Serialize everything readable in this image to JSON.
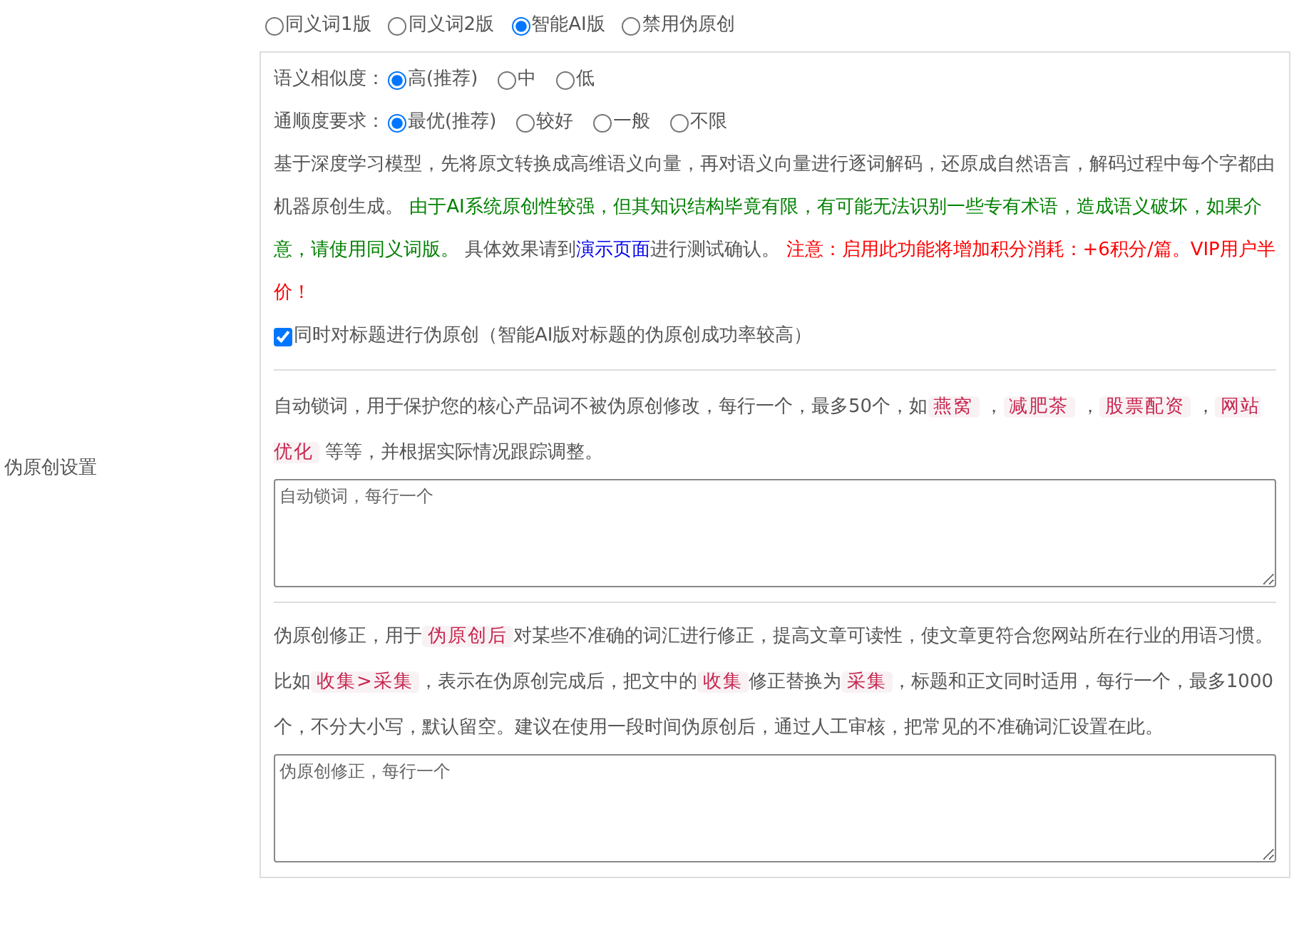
{
  "section_label": "伪原创设置",
  "modes": [
    {
      "label": "同义词1版",
      "selected": false
    },
    {
      "label": "同义词2版",
      "selected": false
    },
    {
      "label": "智能AI版",
      "selected": true
    },
    {
      "label": "禁用伪原创",
      "selected": false
    }
  ],
  "similarity": {
    "label": "语义相似度：",
    "options": [
      {
        "label": "高(推荐)",
        "selected": true
      },
      {
        "label": "中",
        "selected": false
      },
      {
        "label": "低",
        "selected": false
      }
    ]
  },
  "fluency": {
    "label": "通顺度要求：",
    "options": [
      {
        "label": "最优(推荐)",
        "selected": true
      },
      {
        "label": "较好",
        "selected": false
      },
      {
        "label": "一般",
        "selected": false
      },
      {
        "label": "不限",
        "selected": false
      }
    ]
  },
  "ai_description": [
    {
      "kind": "text",
      "text": "基于深度学习模型，先将原文转换成高维语义向量，再对语义向量进行逐词解码，还原成自然语言，解码过程中每个字都由机器原创生成。 "
    },
    {
      "kind": "green",
      "text": "由于AI系统原创性较强，但其知识结构毕竟有限，有可能无法识别一些专有术语，造成语义破坏，如果介意，请使用同义词版。"
    },
    {
      "kind": "text",
      "text": " 具体效果请到"
    },
    {
      "kind": "link",
      "text": "演示页面"
    },
    {
      "kind": "text",
      "text": "进行测试确认。 "
    },
    {
      "kind": "warn",
      "text": "注意：启用此功能将增加积分消耗：+6积分/篇。VIP用户半价！"
    }
  ],
  "title_option": {
    "label": "同时对标题进行伪原创（智能AI版对标题的伪原创成功率较高）",
    "checked": true
  },
  "lock_words": {
    "description": [
      {
        "kind": "text",
        "text": "自动锁词，用于保护您的核心产品词不被伪原创修改，每行一个，最多50个，如"
      },
      {
        "kind": "tag",
        "text": "燕窝"
      },
      {
        "kind": "text",
        "text": " ，"
      },
      {
        "kind": "tag",
        "text": "减肥茶"
      },
      {
        "kind": "text",
        "text": " ，"
      },
      {
        "kind": "tag",
        "text": "股票配资"
      },
      {
        "kind": "text",
        "text": " ，"
      },
      {
        "kind": "tag",
        "text": "网站优化"
      },
      {
        "kind": "text",
        "text": " 等等，并根据实际情况跟踪调整。"
      }
    ],
    "placeholder": "自动锁词，每行一个"
  },
  "correction": {
    "description": [
      {
        "kind": "text",
        "text": "伪原创修正，用于"
      },
      {
        "kind": "tag",
        "text": "伪原创后"
      },
      {
        "kind": "text",
        "text": "对某些不准确的词汇进行修正，提高文章可读性，使文章更符合您网站所在行业的用语习惯。比如"
      },
      {
        "kind": "tag",
        "text": "收集>采集"
      },
      {
        "kind": "text",
        "text": "，表示在伪原创完成后，把文中的"
      },
      {
        "kind": "tag",
        "text": "收集"
      },
      {
        "kind": "text",
        "text": "修正替换为"
      },
      {
        "kind": "tag",
        "text": "采集"
      },
      {
        "kind": "text",
        "text": "，标题和正文同时适用，每行一个，最多1000个，不分大小写，默认留空。建议在使用一段时间伪原创后，通过人工审核，把常见的不准确词汇设置在此。"
      }
    ],
    "placeholder": "伪原创修正，每行一个"
  }
}
